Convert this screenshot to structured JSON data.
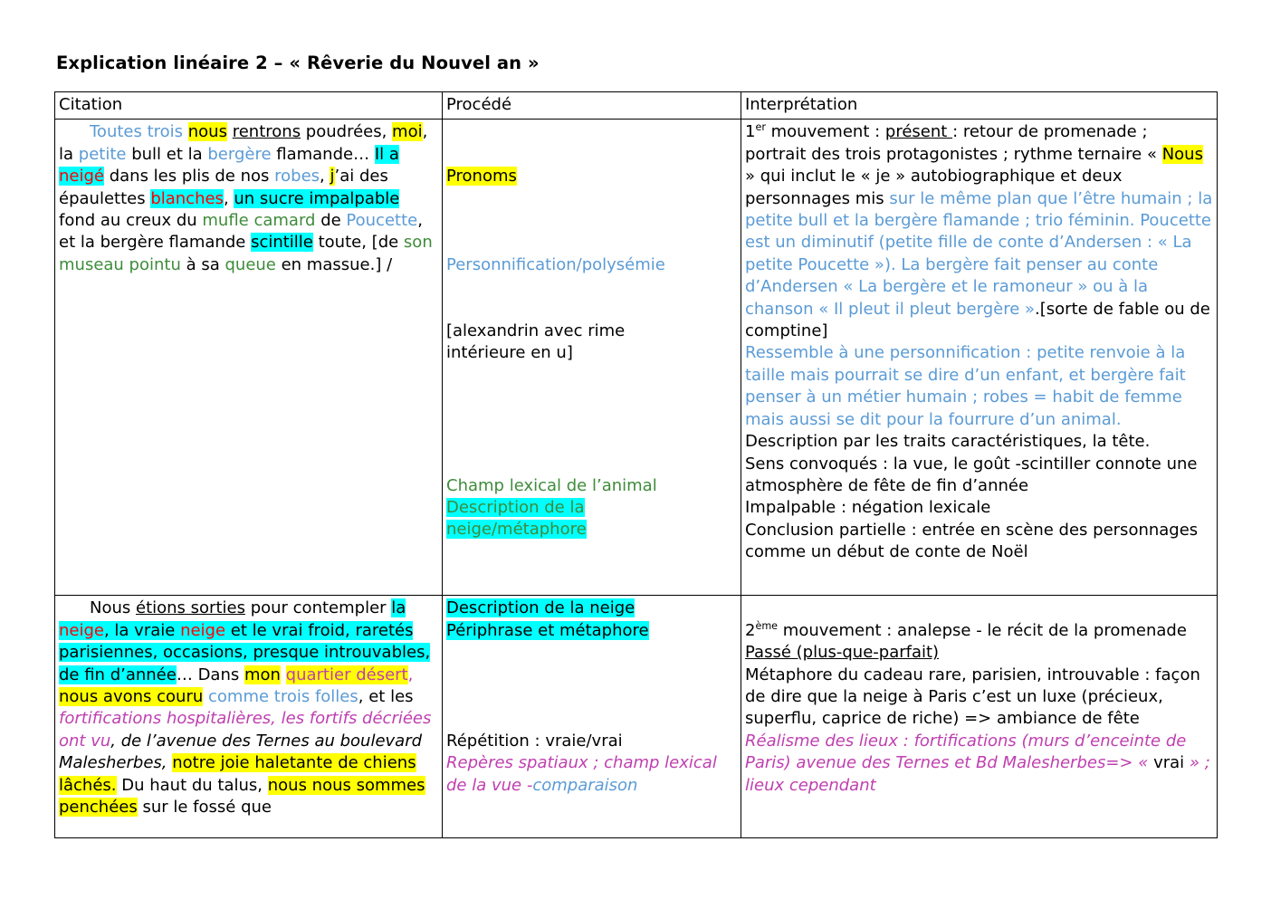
{
  "document": {
    "title": "Explication linéaire 2 – « Rêverie du Nouvel an »"
  },
  "table": {
    "headers": {
      "citation": "Citation",
      "procede": "Procédé",
      "interpretation": "Interprétation"
    },
    "rows": [
      {
        "citation_text": "    Toutes trois nous rentrons poudrées, moi, la petite bull et la bergère flamande… Il a neigé dans les plis de nos robes, j’ai des épaulettes blanches, un sucre impalpable fond au creux du mufle camard de Poucette, et la bergère flamande scintille toute, [de son museau pointu à sa queue en massue.] /",
        "procede_items": [
          "Pronoms",
          "Personnification/polysémie",
          "[alexandrin avec rime intérieure en u]",
          "Champ lexical de l’animal",
          "Description de la neige/métaphore"
        ],
        "interpretation_items": [
          "1er mouvement : présent : retour de promenade ; portrait des trois protagonistes ; rythme ternaire « Nous » qui inclut le « je » autobiographique et deux personnages mis sur le même plan que l’être humain ; la petite bull et la bergère flamande ; trio féminin. Poucette est un diminutif (petite fille de conte d’Andersen : « La petite Poucette »). La bergère fait penser au conte d’Andersen « La bergère et le ramoneur » ou à la chanson «  Il pleut il pleut bergère ».[sorte de fable ou de comptine]",
          "Ressemble à une personnification : petite renvoie à la taille mais pourrait se dire d’un enfant, et bergère fait penser à un métier humain ; robes = habit de femme mais aussi se dit pour la fourrure d’un animal.",
          "Description par les traits caractéristiques, la tête.",
          "Sens convoqués : la vue, le goût -scintiller connote une atmosphère de fête de fin d’année",
          "Impalpable : négation lexicale",
          "Conclusion partielle : entrée en scène des personnages comme un début de conte de Noël"
        ]
      },
      {
        "citation_text": "    Nous étions sorties pour contempler la neige, la vraie neige et le vrai froid, raretés parisiennes, occasions, presque introuvables, de fin d’année… Dans mon quartier désert, nous avons couru comme trois folles, et les fortifications hospitalières, les fortifs décriées ont vu, de l’avenue des Ternes au boulevard Malesherbes, notre joie haletante de chiens lâchés. Du haut du talus, nous nous sommes penchées sur le fossé que",
        "procede_items": [
          "Description de la neige",
          "Périphrase et métaphore",
          "Répétition : vraie/vrai",
          "Repères spatiaux ; champ lexical de la vue -comparaison"
        ],
        "interpretation_items": [
          "2ème mouvement : analepse - le récit de la promenade",
          "Passé (plus-que-parfait)",
          "Métaphore du cadeau rare, parisien, introuvable : façon de dire que la neige à Paris c’est un luxe (précieux, superflu, caprice de riche) => ambiance de fête",
          "Réalisme des lieux : fortifications (murs d’enceinte de Paris) avenue des Ternes et Bd Malesherbes=> « vrai » ; lieux cependant"
        ]
      }
    ]
  },
  "colors": {
    "blue": "#5B9BD5",
    "green": "#3E8C3A",
    "red": "#FF0000",
    "magenta": "#BF3FB0",
    "highlight_yellow": "#FFFF00",
    "highlight_cyan": "#00FFFF",
    "text": "#000000",
    "border": "#000000"
  }
}
